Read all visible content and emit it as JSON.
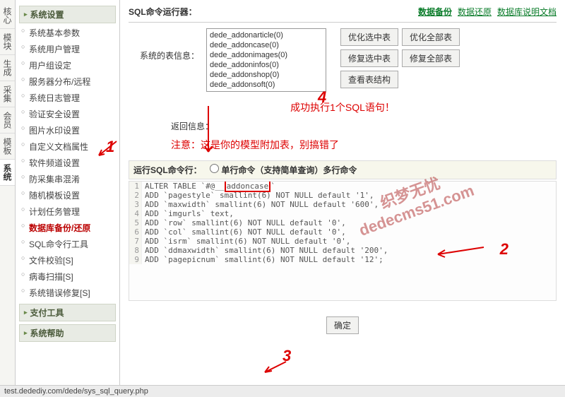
{
  "tabs": [
    "核心",
    "模块",
    "生成",
    "采集",
    "会员",
    "模板",
    "系统"
  ],
  "active_tab": 6,
  "sidebar": {
    "groups": [
      {
        "title": "系统设置",
        "items": [
          "系统基本参数",
          "系统用户管理",
          "用户组设定",
          "服务器分布/远程",
          "系统日志管理",
          "验证安全设置",
          "图片水印设置",
          "自定义文档属性",
          "软件频道设置",
          "防采集串混淆",
          "随机模板设置",
          "计划任务管理",
          "数据库备份/还原",
          "SQL命令行工具",
          "文件校验[S]",
          "病毒扫描[S]",
          "系统错误修复[S]"
        ],
        "active_index": 12
      },
      {
        "title": "支付工具",
        "items": []
      },
      {
        "title": "系统帮助",
        "items": []
      }
    ]
  },
  "header": {
    "title": "SQL命令运行器：",
    "links": [
      "数据备份",
      "数据还原",
      "数据库说明文档"
    ],
    "active_link": 0
  },
  "table_info": {
    "label": "系统的表信息：",
    "tables": [
      "dede_addonarticle(0)",
      "dede_addoncase(0)",
      "dede_addonimages(0)",
      "dede_addoninfos(0)",
      "dede_addonshop(0)",
      "dede_addonsoft(0)"
    ]
  },
  "action_buttons": [
    "优化选中表",
    "优化全部表",
    "修复选中表",
    "修复全部表",
    "查看表结构"
  ],
  "success_msg": "成功执行1个SQL语句！",
  "return_label": "返回信息：",
  "notice_text": "注意：这是你的模型附加表，别搞错了",
  "sql_section": {
    "label": "运行SQL命令行：",
    "radio_label": "单行命令（支持简单查询）多行命令"
  },
  "sql_lines": [
    {
      "n": 1,
      "text": "ALTER TABLE `#@__addoncase`"
    },
    {
      "n": 2,
      "text": "ADD `pagestyle` smallint(6) NOT NULL default '1',"
    },
    {
      "n": 3,
      "text": "ADD `maxwidth` smallint(6) NOT NULL default '600',"
    },
    {
      "n": 4,
      "text": "ADD `imgurls` text,"
    },
    {
      "n": 5,
      "text": "ADD `row` smallint(6) NOT NULL default '0',"
    },
    {
      "n": 6,
      "text": "ADD `col` smallint(6) NOT NULL default '0',"
    },
    {
      "n": 7,
      "text": "ADD `isrm` smallint(6) NOT NULL default '0',"
    },
    {
      "n": 8,
      "text": "ADD `ddmaxwidth` smallint(6) NOT NULL default '200',"
    },
    {
      "n": 9,
      "text": "ADD `pagepicnum` smallint(6) NOT NULL default '12';"
    }
  ],
  "submit_label": "确定",
  "status_url": "test.dedediy.com/dede/sys_sql_query.php",
  "annotations": {
    "1": "1",
    "2": "2",
    "3": "3",
    "4": "4"
  },
  "watermark_lines": [
    "织梦无忧",
    "dedecms51.com"
  ]
}
